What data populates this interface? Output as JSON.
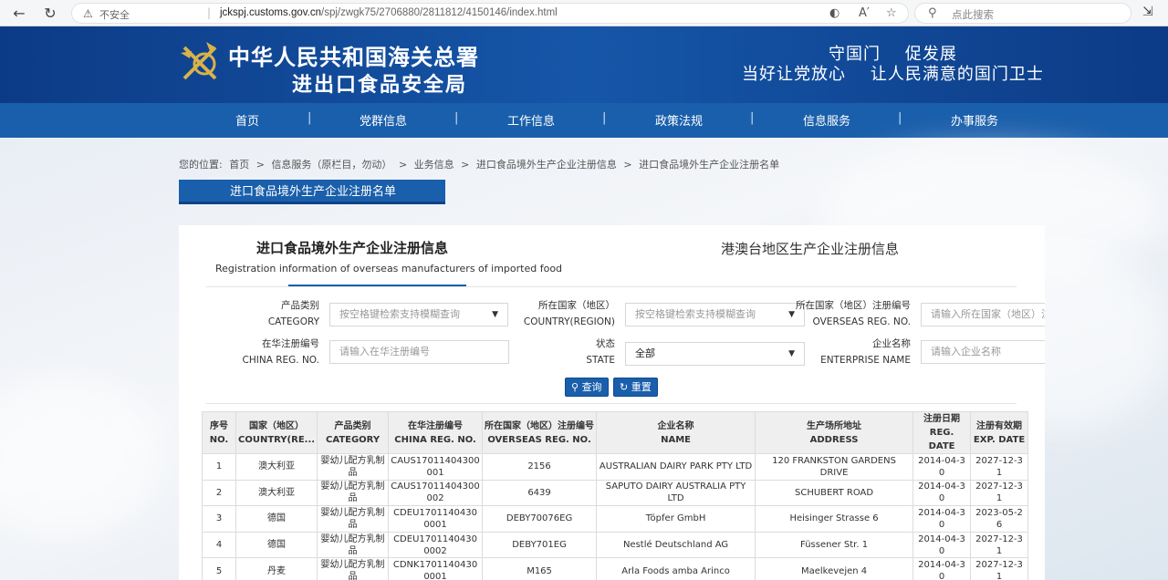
{
  "browser": {
    "insecure_label": "不安全",
    "url_host": "jckspj.customs.gov.cn",
    "url_path": "/spj/zwgk75/2706880/2811812/4150146/index.html",
    "search_placeholder": "点此搜索",
    "icons": [
      "back-arrow-icon",
      "reload-icon",
      "warning-icon",
      "translate-icon",
      "read-aloud-icon",
      "favorite-star-icon",
      "search-icon",
      "extensions-icon"
    ]
  },
  "header": {
    "org_title": "中华人民共和国海关总署",
    "org_subtitle": "进出口食品安全局",
    "slogan_line1": "守国门    促发展",
    "slogan_line2": "当好让党放心    让人民满意的国门卫士",
    "colors": {
      "header_bg": "#0c3b86",
      "nav_bg": "#1a5fab",
      "accent": "#1a5fab"
    }
  },
  "nav": {
    "items": [
      "首页",
      "党群信息",
      "工作信息",
      "政策法规",
      "信息服务",
      "办事服务"
    ]
  },
  "breadcrumb": {
    "prefix": "您的位置:",
    "items": [
      "首页",
      ">",
      "信息服务（原栏目，勿动）",
      ">",
      "业务信息",
      ">",
      "进口食品境外生产企业注册信息",
      ">",
      "进口食品境外生产企业注册名单"
    ]
  },
  "section_tab": "进口食品境外生产企业注册名单",
  "tabs": {
    "main_zh": "进口食品境外生产企业注册信息",
    "main_en": "Registration information of overseas manufacturers of imported food",
    "hk": "港澳台地区生产企业注册信息"
  },
  "filters": {
    "category_zh": "产品类别",
    "category_en": "CATEGORY",
    "category_placeholder": "按空格键检索支持模糊查询",
    "country_zh": "所在国家（地区）",
    "country_en": "COUNTRY(REGION)",
    "country_placeholder": "按空格键检索支持模糊查询",
    "overseas_zh": "所在国家（地区）注册编号",
    "overseas_en": "OVERSEAS REG. NO.",
    "overseas_placeholder": "请输入所在国家（地区）注册编号",
    "china_zh": "在华注册编号",
    "china_en": "CHINA REG. NO.",
    "china_placeholder": "请输入在华注册编号",
    "state_zh": "状态",
    "state_en": "STATE",
    "state_value": "全部",
    "enterprise_zh": "企业名称",
    "enterprise_en": "ENTERPRISE NAME",
    "enterprise_placeholder": "请输入企业名称",
    "query_label": "查询",
    "reset_label": "重置"
  },
  "table": {
    "headers": [
      [
        "序号",
        "NO."
      ],
      [
        "国家（地区）",
        "COUNTRY(RE..."
      ],
      [
        "产品类别",
        "CATEGORY"
      ],
      [
        "在华注册编号",
        "CHINA REG. NO."
      ],
      [
        "所在国家（地区）注册编号",
        "OVERSEAS REG. NO."
      ],
      [
        "企业名称",
        "NAME"
      ],
      [
        "生产场所地址",
        "ADDRESS"
      ],
      [
        "注册日期",
        "REG. DATE"
      ],
      [
        "注册有效期",
        "EXP. DATE"
      ]
    ],
    "rows": [
      [
        "1",
        "澳大利亚",
        "婴幼儿配方乳制品",
        "CAUS17011404300001",
        "2156",
        "AUSTRALIAN DAIRY PARK PTY LTD",
        "120 FRANKSTON GARDENS DRIVE",
        "2014-04-30",
        "2027-12-31"
      ],
      [
        "2",
        "澳大利亚",
        "婴幼儿配方乳制品",
        "CAUS17011404300002",
        "6439",
        "SAPUTO DAIRY AUSTRALIA PTY LTD",
        "SCHUBERT ROAD",
        "2014-04-30",
        "2027-12-31"
      ],
      [
        "3",
        "德国",
        "婴幼儿配方乳制品",
        "CDEU17011404300001",
        "DEBY70076EG",
        "Töpfer GmbH",
        "Heisinger Strasse 6",
        "2014-04-30",
        "2023-05-26"
      ],
      [
        "4",
        "德国",
        "婴幼儿配方乳制品",
        "CDEU17011404300002",
        "DEBY701EG",
        "Nestlé Deutschland AG",
        "Füssener Str. 1",
        "2014-04-30",
        "2027-12-31"
      ],
      [
        "5",
        "丹麦",
        "婴幼儿配方乳制品",
        "CDNK17011404300001",
        "M165",
        "Arla Foods amba Arinco",
        "Maelkevejen 4",
        "2014-04-30",
        "2027-12-31"
      ]
    ]
  }
}
